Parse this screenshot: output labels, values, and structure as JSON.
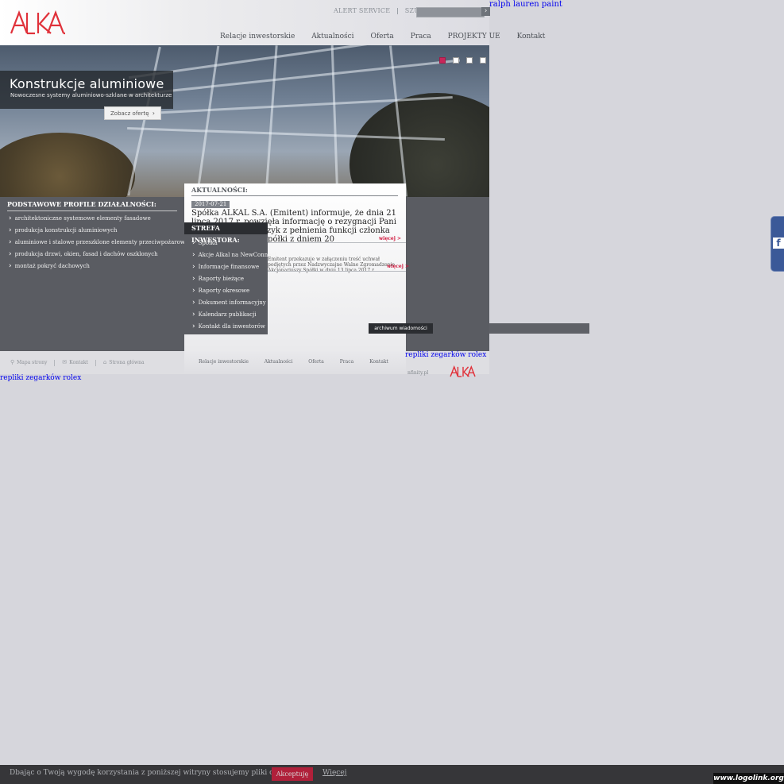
{
  "header": {
    "topbar": {
      "alert": "ALERT SERVICE",
      "search_label": "SZUKAJ:",
      "search_value": ""
    },
    "ralph_link": "ralph lauren paint",
    "nav": [
      "Relacje inwestorskie",
      "Aktualności",
      "Oferta",
      "Praca",
      "PROJEKTY UE",
      "Kontakt"
    ]
  },
  "hero": {
    "title": "Konstrukcje aluminiowe",
    "subtitle": "Nowoczesne systemy aluminiowo-szklane w architekturze",
    "button": "Zobacz ofertę",
    "slides_active": 1,
    "slides_count": 4
  },
  "profiles": {
    "heading": "PODSTAWOWE PROFILE DZIAŁALNOŚCI:",
    "items": [
      "architektoniczne systemowe elementy fasadowe",
      "produkcja konstrukcji aluminiowych",
      "aluminiowe i stalowe przeszklone elementy przeciwpożarowe",
      "produkcja drzwi, okien, fasad i dachów oszklonych",
      "montaż pokryć dachowych"
    ]
  },
  "news": {
    "heading": "AKTUALNOŚCI:",
    "date": "2017-07-21",
    "title": "Spółka ALKAL S.A. (Emitent) informuje, że dnia 21 lipca 2017 r. powzięła informację o rezygnacji Pani Pauli Lipiec-Krawczyk z pełnienia funkcji członka Rady Nadzorczej Spółki z dniem 20",
    "more": "więcej >",
    "second_text": "Emitent przekazuje w załączeniu treść uchwał podjętych przez Nadzwyczajne Walne Zgromadzenie Akcjonariuszy Spółki w dniu 13 lipca 2017 r.",
    "second_more": "więcej >",
    "archive": "archiwum wiadomości"
  },
  "investor": {
    "heading": "STREFA INWESTORA:",
    "items": [
      "Spółka",
      "Akcje Alkal na NewConnect",
      "Informacje finansowe",
      "Raporty bieżące",
      "Raporty okresowe",
      "Dokument informacyjny",
      "Kalendarz publikacji",
      "Kontakt dla inwestorów"
    ]
  },
  "footer": {
    "links": [
      "Mapa strony",
      "Kontakt",
      "Strona główna"
    ],
    "nav": [
      "Relacje inwestorskie",
      "Aktualności",
      "Oferta",
      "Praca",
      "Kontakt"
    ],
    "rolex1": "repliki zegarków rolex",
    "rolex2": "repliki zegarków rolex",
    "infinity": "nfinity.pl"
  },
  "fb": {
    "letter": "f"
  },
  "cookie": {
    "text": "Dbając o Twoją wygodę korzystania z poniższej witryny stosujemy pliki cookies.",
    "accept": "Akceptuję",
    "more": "Więcej"
  },
  "watermark": "www.logolink.org",
  "colors": {
    "brand_red": "#d0153b",
    "dark": "#2b2d31",
    "panel": "#5a5c62",
    "active_dot": "#c8265a"
  }
}
